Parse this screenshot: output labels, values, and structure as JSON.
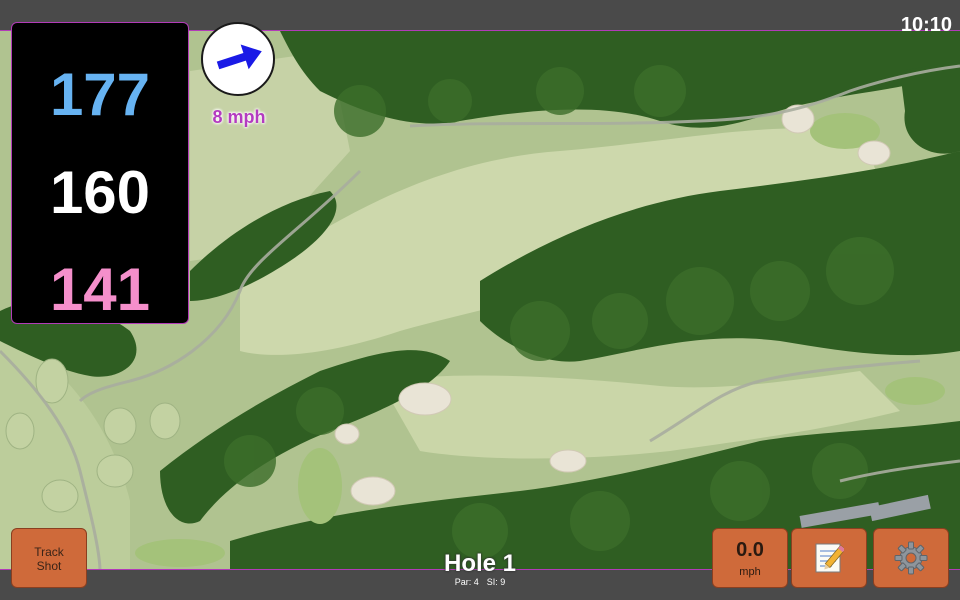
{
  "status_bar": {
    "time": "10:10"
  },
  "distances": {
    "back": "177",
    "center": "160",
    "front": "141"
  },
  "wind": {
    "speed_label": "8 mph",
    "direction_icon": "arrow-icon",
    "arrow_color": "#1a1ae6"
  },
  "buttons": {
    "track_shot_label": "Track\nShot",
    "speed_value": "0.0",
    "speed_unit": "mph",
    "notes_icon": "notepad-icon",
    "settings_icon": "gear-icon"
  },
  "hole": {
    "title": "Hole 1",
    "par_label": "Par: 4",
    "si_label": "SI: 9"
  },
  "colors": {
    "accent_border": "#b23bb8",
    "back_distance": "#67b3f2",
    "center_distance": "#ffffff",
    "front_distance": "#f58fcb",
    "button": "#cf6a3a"
  }
}
